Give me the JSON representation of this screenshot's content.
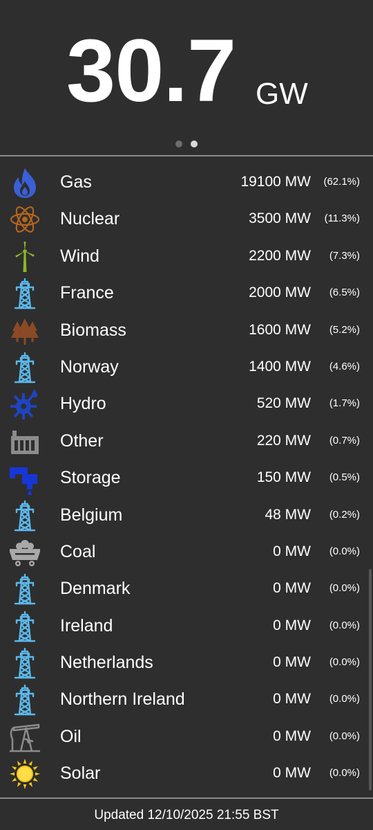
{
  "header": {
    "total_value": "30.7",
    "total_unit": "GW"
  },
  "pager": {
    "page_count": 2,
    "active_page": 2
  },
  "sources": [
    {
      "name": "Gas",
      "mw": "19100 MW",
      "pct": "(62.1%)",
      "icon": "gas-flame-icon"
    },
    {
      "name": "Nuclear",
      "mw": "3500 MW",
      "pct": "(11.3%)",
      "icon": "atom-icon"
    },
    {
      "name": "Wind",
      "mw": "2200 MW",
      "pct": "(7.3%)",
      "icon": "wind-turbine-icon"
    },
    {
      "name": "France",
      "mw": "2000 MW",
      "pct": "(6.5%)",
      "icon": "pylon-icon"
    },
    {
      "name": "Biomass",
      "mw": "1600 MW",
      "pct": "(5.2%)",
      "icon": "trees-icon"
    },
    {
      "name": "Norway",
      "mw": "1400 MW",
      "pct": "(4.6%)",
      "icon": "pylon-icon"
    },
    {
      "name": "Hydro",
      "mw": "520 MW",
      "pct": "(1.7%)",
      "icon": "water-wheel-icon"
    },
    {
      "name": "Other",
      "mw": "220 MW",
      "pct": "(0.7%)",
      "icon": "factory-icon"
    },
    {
      "name": "Storage",
      "mw": "150 MW",
      "pct": "(0.5%)",
      "icon": "water-tap-icon"
    },
    {
      "name": "Belgium",
      "mw": "48 MW",
      "pct": "(0.2%)",
      "icon": "pylon-icon"
    },
    {
      "name": "Coal",
      "mw": "0 MW",
      "pct": "(0.0%)",
      "icon": "coal-cart-icon"
    },
    {
      "name": "Denmark",
      "mw": "0 MW",
      "pct": "(0.0%)",
      "icon": "pylon-icon"
    },
    {
      "name": "Ireland",
      "mw": "0 MW",
      "pct": "(0.0%)",
      "icon": "pylon-icon"
    },
    {
      "name": "Netherlands",
      "mw": "0 MW",
      "pct": "(0.0%)",
      "icon": "pylon-icon"
    },
    {
      "name": "Northern Ireland",
      "mw": "0 MW",
      "pct": "(0.0%)",
      "icon": "pylon-icon"
    },
    {
      "name": "Oil",
      "mw": "0 MW",
      "pct": "(0.0%)",
      "icon": "oil-pump-icon"
    },
    {
      "name": "Solar",
      "mw": "0 MW",
      "pct": "(0.0%)",
      "icon": "sun-icon"
    }
  ],
  "footer": {
    "updated": "Updated 12/10/2025 21:55 BST"
  },
  "colors": {
    "background": "#2e2e2e",
    "text": "#ffffff",
    "divider": "#8a8a8a",
    "gas": "#3a5fd6",
    "nuclear": "#b5651d",
    "wind": "#8db52b",
    "interconnector": "#5bb8ea",
    "biomass": "#8b4a25",
    "hydro": "#1e44c2",
    "other": "#8c8c8c",
    "storage": "#1736d6",
    "coal": "#a8a8a8",
    "oil": "#8c8c8c",
    "solar": "#f5c518"
  }
}
